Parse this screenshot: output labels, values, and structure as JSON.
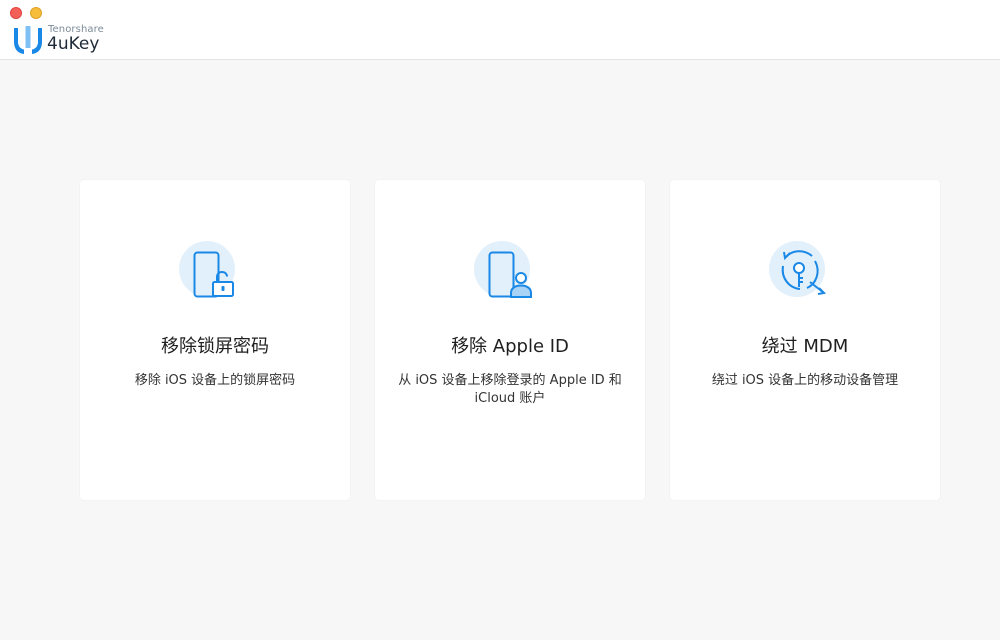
{
  "window": {
    "controls": [
      "close",
      "minimize"
    ]
  },
  "brand": {
    "company": "Tenorshare",
    "product": "4uKey",
    "logo_icon": "tenorshare-logo-icon",
    "accent": "#1a88e6"
  },
  "cards": [
    {
      "title": "移除锁屏密码",
      "description": "移除 iOS 设备上的锁屏密码",
      "icon": "phone-unlock-icon"
    },
    {
      "title": "移除 Apple ID",
      "description": "从 iOS 设备上移除登录的 Apple ID 和 iCloud 账户",
      "icon": "phone-account-icon"
    },
    {
      "title": "绕过 MDM",
      "description": "绕过 iOS 设备上的移动设备管理",
      "icon": "key-bypass-icon"
    }
  ],
  "colors": {
    "icon_blue": "#1a88e6",
    "icon_bg": "#e2f0fb",
    "page_bg": "#f7f7f7",
    "card_bg": "#ffffff"
  }
}
